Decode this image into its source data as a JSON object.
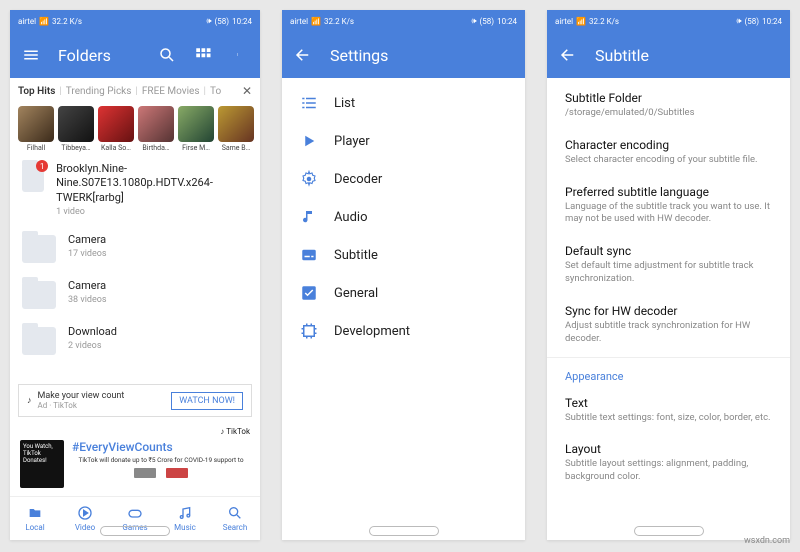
{
  "status": {
    "carrier": "airtel",
    "net": "32.2 K/s",
    "time": "10:24",
    "battery": "58"
  },
  "screen1": {
    "title": "Folders",
    "tabs": [
      "Top Hits",
      "Trending Picks",
      "FREE Movies",
      "To"
    ],
    "thumbs": [
      "Filhall",
      "Tibbeya…",
      "Kalla So…",
      "Birthda…",
      "Firse M…",
      "Same B…"
    ],
    "folders": [
      {
        "title": "Brooklyn.Nine-Nine.S07E13.1080p.HDTV.x264-TWERK[rarbg]",
        "sub": "1 video",
        "badge": "1"
      },
      {
        "title": "Camera",
        "sub": "17 videos"
      },
      {
        "title": "Camera",
        "sub": "38 videos"
      },
      {
        "title": "Download",
        "sub": "2 videos"
      }
    ],
    "ad": {
      "title": "Make your view count",
      "source": "Ad · TikTok",
      "cta": "WATCH NOW!"
    },
    "promo": {
      "tiktok": "TikTok",
      "tile": "You Watch, TikTok Donates!",
      "hash": "#EveryViewCounts",
      "sub": "TikTok will donate up to\n₹5 Crore for COVID-19 support to"
    },
    "nav": [
      "Local",
      "Video",
      "Games",
      "Music",
      "Search"
    ]
  },
  "screen2": {
    "title": "Settings",
    "items": [
      "List",
      "Player",
      "Decoder",
      "Audio",
      "Subtitle",
      "General",
      "Development"
    ]
  },
  "screen3": {
    "title": "Subtitle",
    "items": [
      {
        "t": "Subtitle Folder",
        "d": "/storage/emulated/0/Subtitles"
      },
      {
        "t": "Character encoding",
        "d": "Select character encoding of your subtitle file."
      },
      {
        "t": "Preferred subtitle language",
        "d": "Language of the subtitle track you want to use. It may not be used with HW decoder."
      },
      {
        "t": "Default sync",
        "d": "Set default time adjustment for subtitle track synchronization."
      },
      {
        "t": "Sync for HW decoder",
        "d": "Adjust subtitle track synchronization for HW decoder."
      }
    ],
    "section": "Appearance",
    "more": [
      {
        "t": "Text",
        "d": "Subtitle text settings: font, size, color, border, etc."
      },
      {
        "t": "Layout",
        "d": "Subtitle layout settings: alignment, padding, background color."
      }
    ]
  },
  "watermark": "wsxdn.com"
}
